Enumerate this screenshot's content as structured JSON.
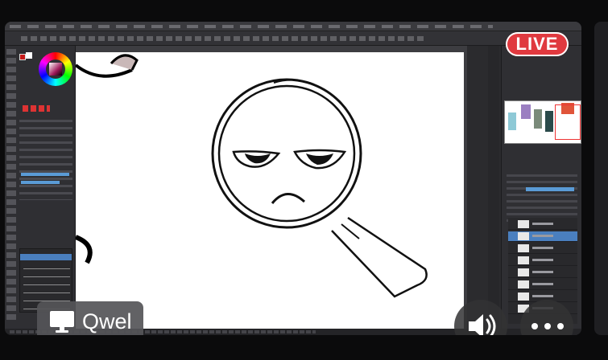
{
  "stream": {
    "live_label": "LIVE",
    "participant_name": "Qwel"
  },
  "icons": {
    "screen_share": "monitor-icon",
    "volume": "speaker-icon",
    "more": "more-options-icon"
  },
  "colors": {
    "live_badge": "#e0393f",
    "canvas": "#ffffff",
    "app_chrome": "#2f2f33",
    "selection_blue": "#4a7fbf",
    "foreground_swatch": "#c71a1a"
  }
}
